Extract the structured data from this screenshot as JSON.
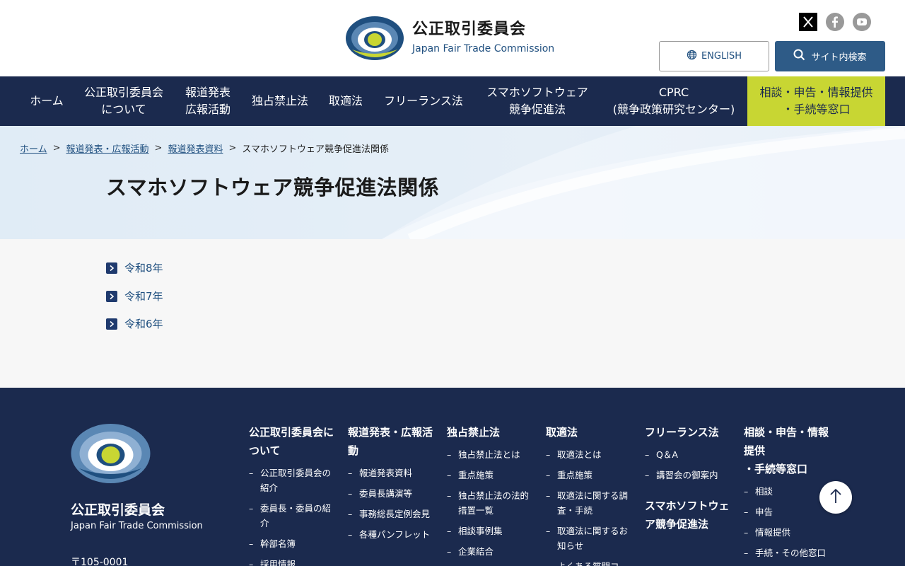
{
  "header": {
    "org_jp": "公正取引委員会",
    "org_en": "Japan Fair Trade Commission",
    "english_label": "ENGLISH",
    "search_label": "サイト内検索",
    "social": [
      "x-icon",
      "facebook-icon",
      "youtube-icon"
    ]
  },
  "nav": {
    "items": [
      {
        "label": "ホーム"
      },
      {
        "label": "公正取引委員会\nについて"
      },
      {
        "label": "報道発表\n広報活動"
      },
      {
        "label": "独占禁止法"
      },
      {
        "label": "取適法"
      },
      {
        "label": "フリーランス法"
      },
      {
        "label": "スマホソフトウェア\n競争促進法"
      },
      {
        "label": "CPRC\n(競争政策研究センター)"
      },
      {
        "label": "相談・申告・情報提供\n・手続等窓口"
      }
    ]
  },
  "breadcrumb": {
    "items": [
      "ホーム",
      "報道発表・広報活動",
      "報道発表資料"
    ],
    "separator": ">",
    "current": "スマホソフトウェア競争促進法関係"
  },
  "page": {
    "title": "スマホソフトウェア競争促進法関係"
  },
  "links": [
    {
      "label": "令和8年"
    },
    {
      "label": "令和7年"
    },
    {
      "label": "令和6年"
    }
  ],
  "footer": {
    "org_jp": "公正取引委員会",
    "org_en": "Japan Fair Trade Commission",
    "zip": "〒105-0001",
    "columns": [
      {
        "title": "公正取引委員会について",
        "items": [
          "公正取引委員会の紹介",
          "委員長・委員の紹介",
          "幹部名簿",
          "採用情報"
        ]
      },
      {
        "title": "報道発表・広報活動",
        "items": [
          "報道発表資料",
          "委員長講演等",
          "事務総長定例会見",
          "各種パンフレット"
        ]
      },
      {
        "title": "独占禁止法",
        "items": [
          "独占禁止法とは",
          "重点施策",
          "独占禁止法の法的措置一覧",
          "相談事例集",
          "企業結合"
        ]
      },
      {
        "title": "取適法",
        "items": [
          "取適法とは",
          "重点施策",
          "取適法に関する調査・手続",
          "取適法に関するお知らせ",
          "よくある質問コ"
        ]
      },
      {
        "title": "フリーランス法",
        "items": [
          "Q＆A",
          "講習会の御案内"
        ],
        "title2": "スマホソフトウェア競争促進法"
      },
      {
        "title": "相談・申告・情報提供\n・手続等窓口",
        "items": [
          "相談",
          "申告",
          "情報提供",
          "手続・その他窓口"
        ]
      }
    ]
  },
  "colors": {
    "navy": "#1b2a4e",
    "accent": "#c8d633",
    "link": "#1f4f7f",
    "search_button": "#2e5b87"
  }
}
